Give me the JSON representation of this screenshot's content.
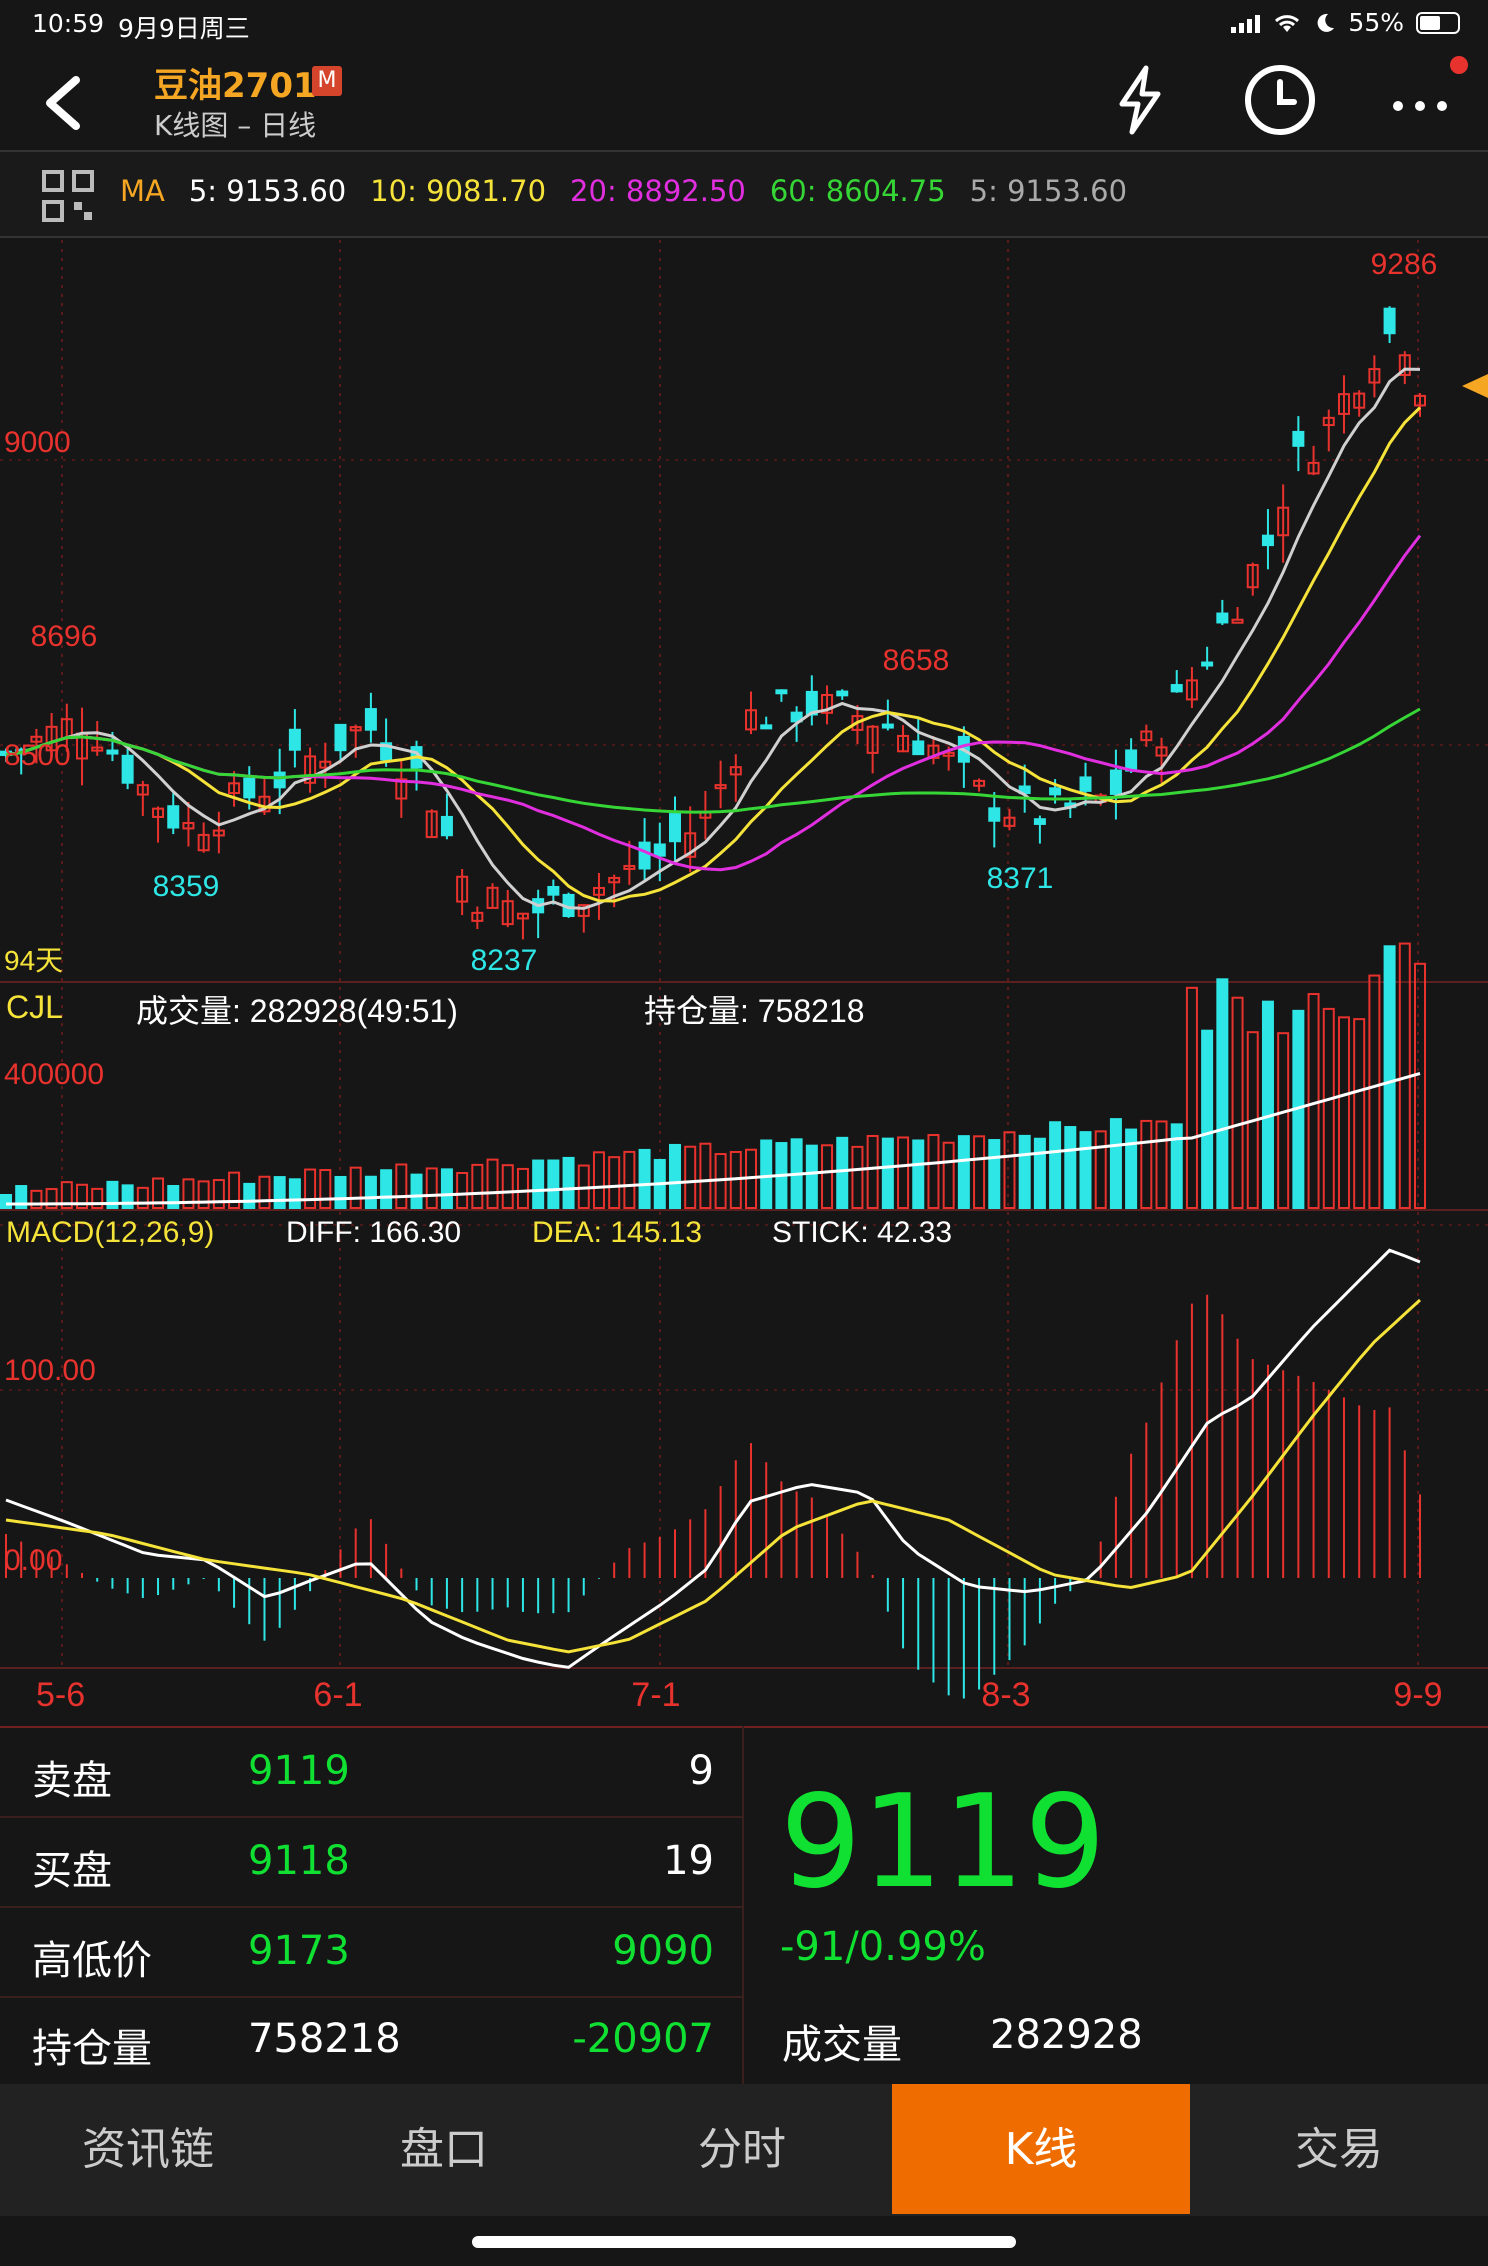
{
  "status": {
    "time": "10:59",
    "date": "9月9日周三",
    "battery": "55%",
    "battery_level": 0.55
  },
  "header": {
    "title": "豆油2701",
    "badge": "M",
    "subtitle": "K线图 – 日线"
  },
  "icons": {
    "back": "back-arrow-icon",
    "flash": "lightning-icon",
    "history": "clock-icon",
    "more": "more-dots-icon",
    "grid": "grid-icon"
  },
  "ma_bar": {
    "label": "MA",
    "items": [
      {
        "text": "5: 9153.60",
        "color": "#ffffff"
      },
      {
        "text": "10: 9081.70",
        "color": "#f5e33a"
      },
      {
        "text": "20: 8892.50",
        "color": "#e12fe0"
      },
      {
        "text": "60: 8604.75",
        "color": "#36d636"
      },
      {
        "text": "5: 9153.60",
        "color": "#aaaaaa"
      }
    ]
  },
  "chart_data": [
    {
      "type": "candlestick",
      "price_axis_labels": [
        "9000",
        "8500"
      ],
      "annotations": {
        "high": "9286",
        "h1": "8696",
        "h2": "8658",
        "l1": "8359",
        "l2": "8237",
        "l3": "8371"
      },
      "days_label": "94天",
      "ylim": [
        8150,
        9320
      ],
      "colors": {
        "up": "#e8322d",
        "down": "#2ee6e6",
        "ma5": "#d0d0d0",
        "ma10": "#f5e33a",
        "ma20": "#e12fe0",
        "ma60": "#36d636"
      }
    },
    {
      "type": "bar",
      "label": "CJL",
      "volume_text": "成交量: 282928(49:51)",
      "oi_text": "持仓量: 758218",
      "axis_label": "400000"
    },
    {
      "type": "bar",
      "label": "MACD(12,26,9)",
      "diff": "DIFF: 166.30",
      "dea": "DEA: 145.13",
      "stick": "STICK: 42.33",
      "axis_labels": [
        "100.00",
        "0.00"
      ]
    }
  ],
  "x_axis": [
    "5-6",
    "6-1",
    "7-1",
    "8-3",
    "9-9"
  ],
  "quote": {
    "rows": [
      {
        "label": "卖盘",
        "v1": "9119",
        "v2": "9"
      },
      {
        "label": "买盘",
        "v1": "9118",
        "v2": "19"
      },
      {
        "label": "高低价",
        "v1": "9173",
        "v2": "9090"
      },
      {
        "label": "持仓量",
        "v1": "758218",
        "v2": "-20907"
      }
    ],
    "price": "9119",
    "change": "-91/0.99%",
    "volume_label": "成交量",
    "volume": "282928"
  },
  "tabs": [
    {
      "label": "资讯链"
    },
    {
      "label": "盘口"
    },
    {
      "label": "分时"
    },
    {
      "label": "K线",
      "active": true
    },
    {
      "label": "交易"
    }
  ]
}
